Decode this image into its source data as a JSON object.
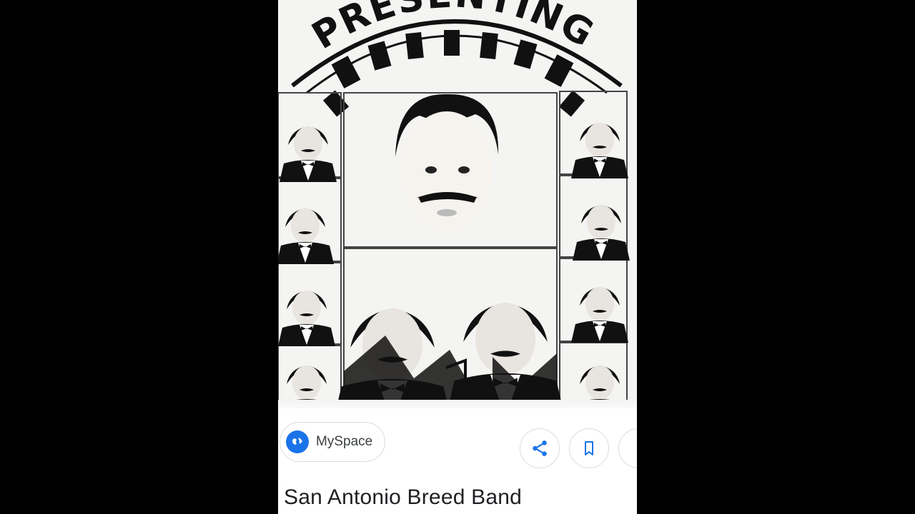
{
  "image": {
    "banner_text": "PRESENTING"
  },
  "source": {
    "label": "MySpace",
    "icon": "globe-icon"
  },
  "actions": {
    "share_icon": "share-icon",
    "save_icon": "bookmark-icon",
    "more_icon": "more-icon"
  },
  "result": {
    "title": "San Antonio Breed Band"
  },
  "colors": {
    "accent": "#1a73e8",
    "background": "#000000",
    "card": "#ffffff"
  }
}
